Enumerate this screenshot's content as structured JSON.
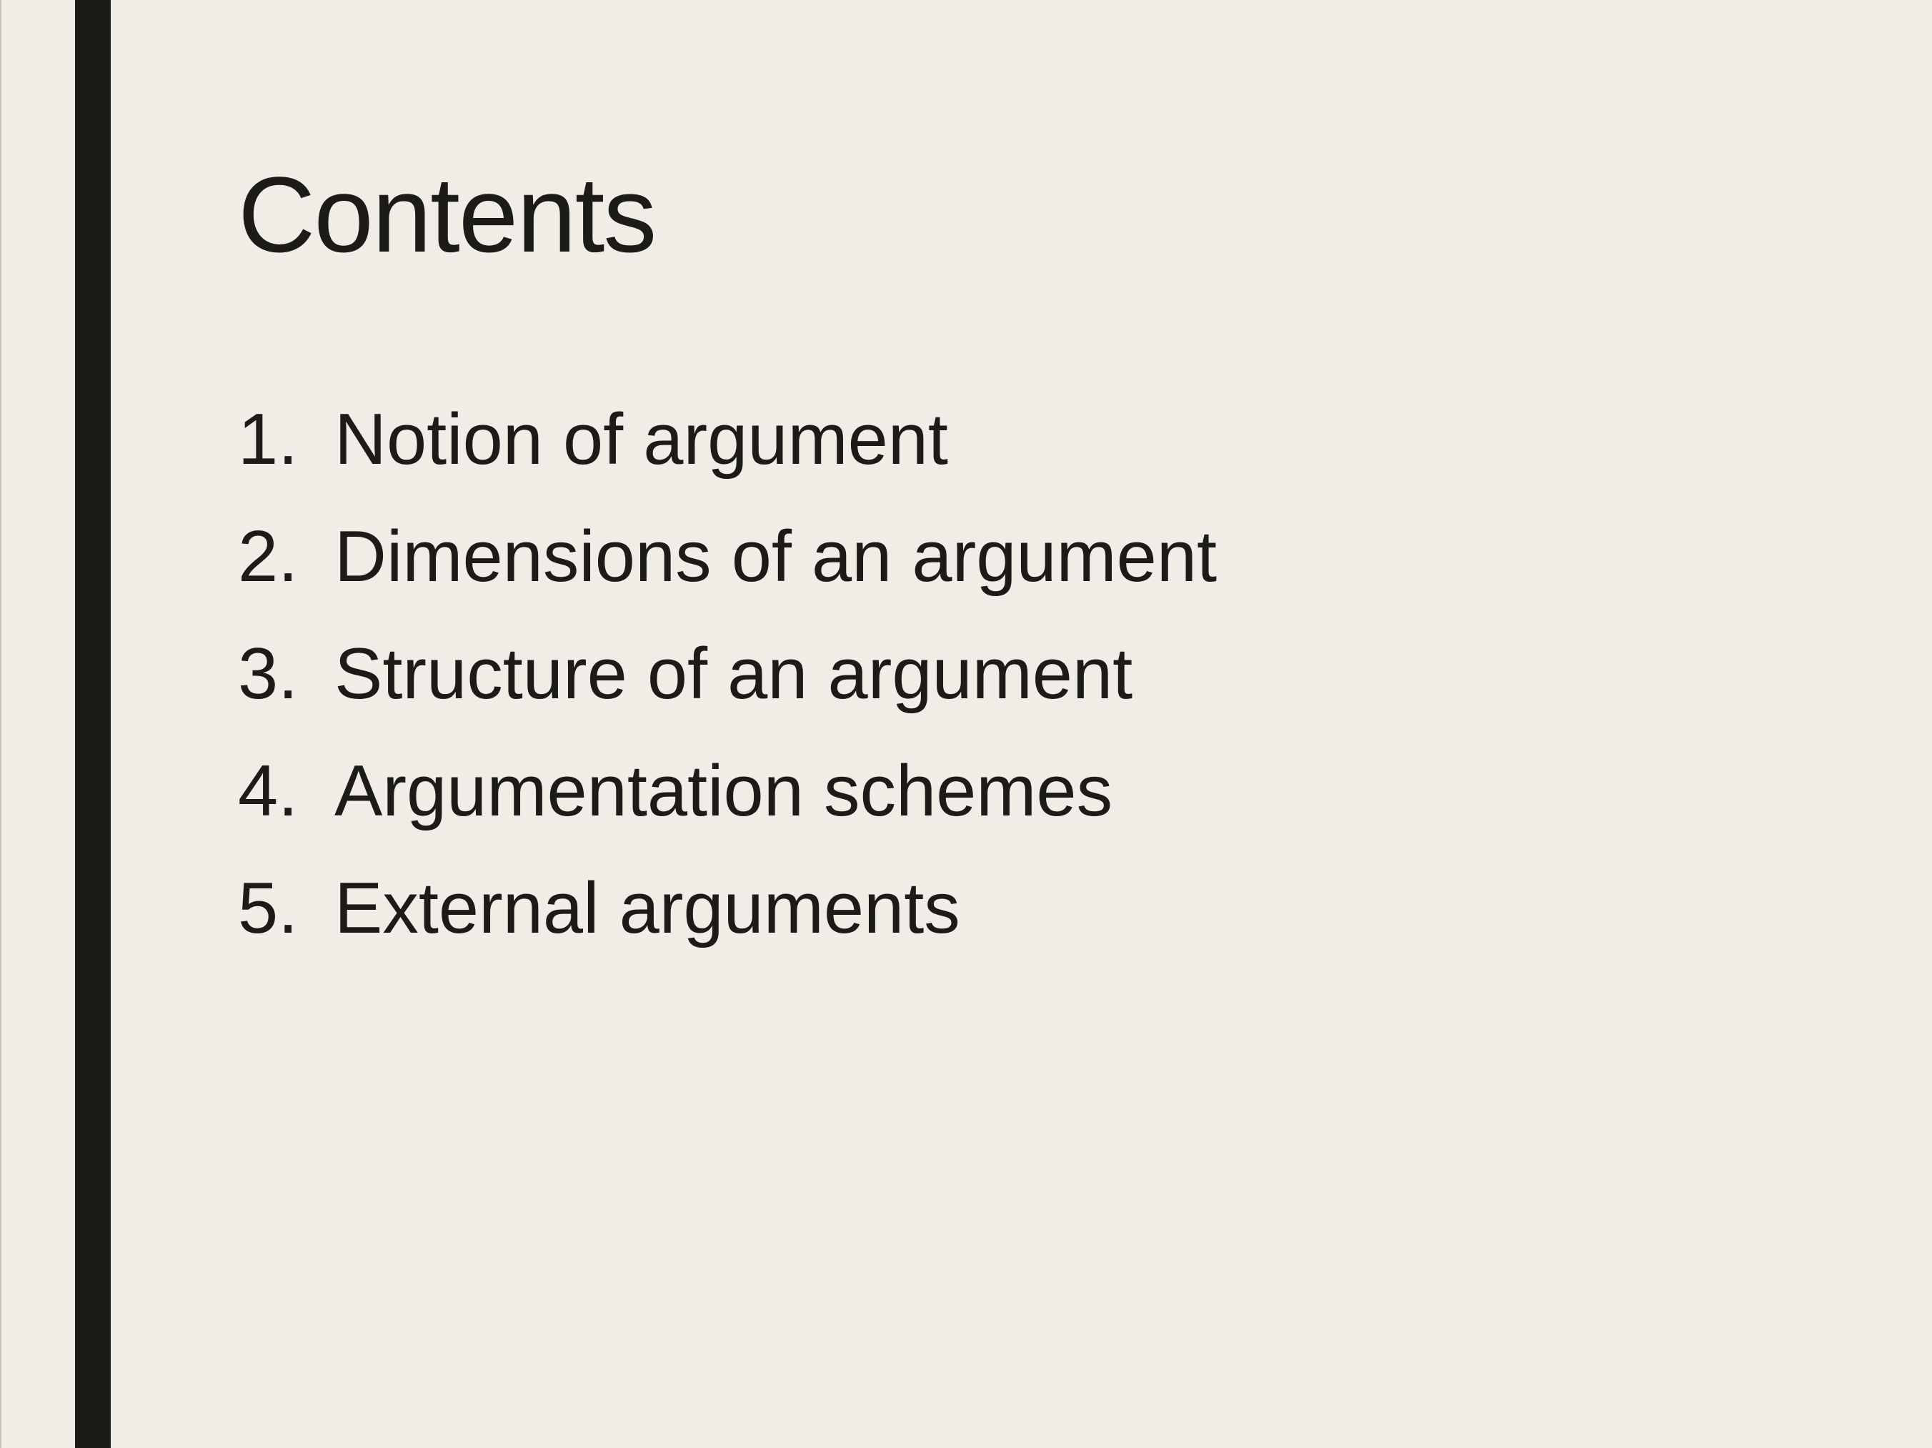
{
  "slide": {
    "title": "Contents",
    "items": [
      {
        "number": "1.",
        "text": "Notion of argument"
      },
      {
        "number": "2.",
        "text": "Dimensions of an argument"
      },
      {
        "number": "3.",
        "text": "Structure of an argument"
      },
      {
        "number": "4.",
        "text": "Argumentation schemes"
      },
      {
        "number": "5.",
        "text": "External arguments"
      }
    ]
  },
  "colors": {
    "background": "#f0ece6",
    "accent_bar": "#1c1b16",
    "text": "#1c1b16"
  }
}
